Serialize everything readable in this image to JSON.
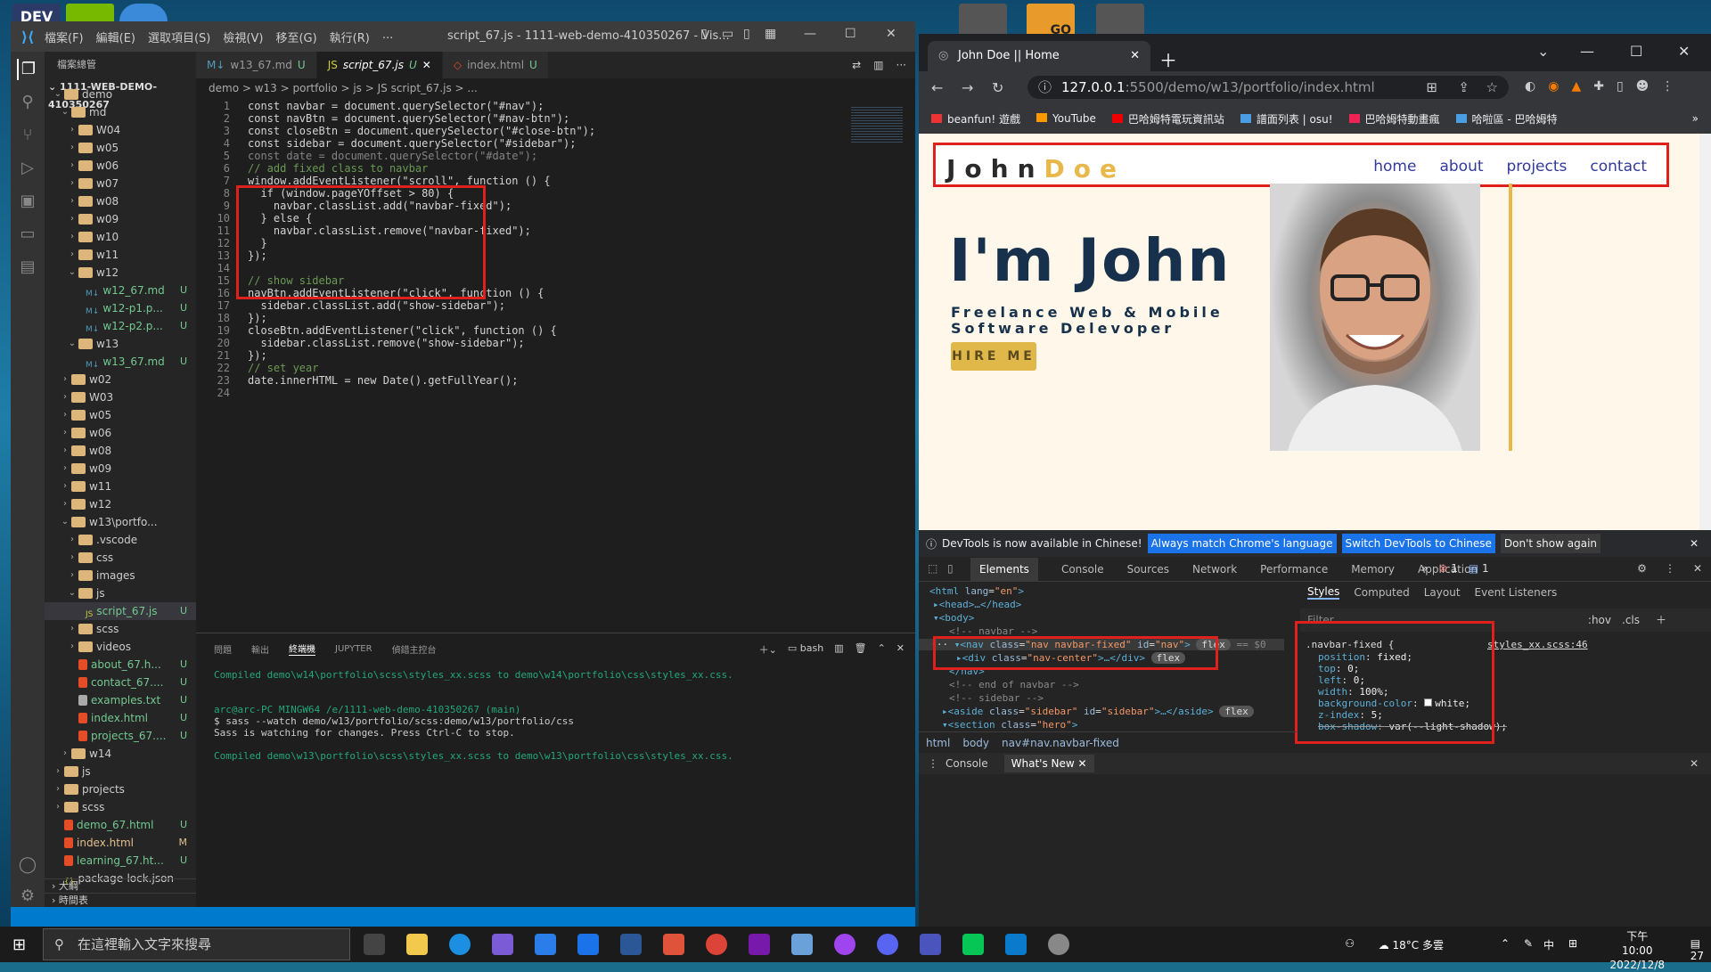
{
  "desktop": {
    "icons": [
      "DEV",
      "",
      "",
      "",
      "GO",
      ""
    ]
  },
  "vscode": {
    "menu": [
      "檔案(F)",
      "編輯(E)",
      "選取項目(S)",
      "檢視(V)",
      "移至(G)",
      "執行(R)",
      "···"
    ],
    "title": "script_67.js - 1111-web-demo-410350267 - Vis...",
    "explorer_header": "檔案總管",
    "project": "1111-WEB-DEMO-410350267",
    "tree": [
      {
        "label": "demo",
        "depth": 1,
        "type": "folder",
        "open": true,
        "status": ""
      },
      {
        "label": "md",
        "depth": 2,
        "type": "folder",
        "open": true,
        "status": ""
      },
      {
        "label": "W04",
        "depth": 3,
        "type": "folder",
        "status": ""
      },
      {
        "label": "w05",
        "depth": 3,
        "type": "folder",
        "status": ""
      },
      {
        "label": "w06",
        "depth": 3,
        "type": "folder",
        "status": ""
      },
      {
        "label": "w07",
        "depth": 3,
        "type": "folder",
        "status": ""
      },
      {
        "label": "w08",
        "depth": 3,
        "type": "folder",
        "status": ""
      },
      {
        "label": "w09",
        "depth": 3,
        "type": "folder",
        "status": ""
      },
      {
        "label": "w10",
        "depth": 3,
        "type": "folder",
        "status": ""
      },
      {
        "label": "w11",
        "depth": 3,
        "type": "folder",
        "status": ""
      },
      {
        "label": "w12",
        "depth": 3,
        "type": "folder",
        "open": true,
        "status": ""
      },
      {
        "label": "w12_67.md",
        "depth": 4,
        "type": "md",
        "status": "U"
      },
      {
        "label": "w12-p1.p...",
        "depth": 4,
        "type": "md",
        "status": "U"
      },
      {
        "label": "w12-p2.p...",
        "depth": 4,
        "type": "md",
        "status": "U"
      },
      {
        "label": "w13",
        "depth": 3,
        "type": "folder",
        "open": true,
        "status": ""
      },
      {
        "label": "w13_67.md",
        "depth": 4,
        "type": "md",
        "status": "U"
      },
      {
        "label": "w02",
        "depth": 2,
        "type": "folder",
        "status": ""
      },
      {
        "label": "W03",
        "depth": 2,
        "type": "folder",
        "status": ""
      },
      {
        "label": "w05",
        "depth": 2,
        "type": "folder",
        "status": ""
      },
      {
        "label": "w06",
        "depth": 2,
        "type": "folder",
        "status": ""
      },
      {
        "label": "w08",
        "depth": 2,
        "type": "folder",
        "status": ""
      },
      {
        "label": "w09",
        "depth": 2,
        "type": "folder",
        "status": ""
      },
      {
        "label": "w11",
        "depth": 2,
        "type": "folder",
        "status": ""
      },
      {
        "label": "w12",
        "depth": 2,
        "type": "folder",
        "status": ""
      },
      {
        "label": "w13\\portfo...",
        "depth": 2,
        "type": "folder",
        "open": true,
        "status": ""
      },
      {
        "label": ".vscode",
        "depth": 3,
        "type": "folder",
        "status": ""
      },
      {
        "label": "css",
        "depth": 3,
        "type": "folder",
        "status": ""
      },
      {
        "label": "images",
        "depth": 3,
        "type": "folder",
        "status": ""
      },
      {
        "label": "js",
        "depth": 3,
        "type": "folder",
        "open": true,
        "status": ""
      },
      {
        "label": "script_67.js",
        "depth": 4,
        "type": "js",
        "status": "U",
        "selected": true
      },
      {
        "label": "scss",
        "depth": 3,
        "type": "folder",
        "status": ""
      },
      {
        "label": "videos",
        "depth": 3,
        "type": "folder",
        "status": ""
      },
      {
        "label": "about_67.h...",
        "depth": 3,
        "type": "html",
        "status": "U"
      },
      {
        "label": "contact_67....",
        "depth": 3,
        "type": "html",
        "status": "U"
      },
      {
        "label": "examples.txt",
        "depth": 3,
        "type": "txt",
        "status": "U"
      },
      {
        "label": "index.html",
        "depth": 3,
        "type": "html",
        "status": "U"
      },
      {
        "label": "projects_67....",
        "depth": 3,
        "type": "html",
        "status": "U"
      },
      {
        "label": "w14",
        "depth": 2,
        "type": "folder",
        "status": ""
      },
      {
        "label": "js",
        "depth": 1,
        "type": "folder",
        "status": ""
      },
      {
        "label": "projects",
        "depth": 1,
        "type": "folder",
        "status": ""
      },
      {
        "label": "scss",
        "depth": 1,
        "type": "folder",
        "status": ""
      },
      {
        "label": "demo_67.html",
        "depth": 1,
        "type": "html",
        "status": "U"
      },
      {
        "label": "index.html",
        "depth": 1,
        "type": "html",
        "status": "M"
      },
      {
        "label": "learning_67.ht...",
        "depth": 1,
        "type": "html",
        "status": "U"
      },
      {
        "label": "package-lock.json",
        "depth": 1,
        "type": "json",
        "status": ""
      }
    ],
    "outline": "大綱",
    "timeline": "時間表",
    "tabs": [
      {
        "label": "w13_67.md",
        "status": "U",
        "active": false
      },
      {
        "label": "script_67.js",
        "status": "U",
        "active": true
      },
      {
        "label": "index.html",
        "status": "U",
        "active": false
      }
    ],
    "breadcrumb": "demo > w13 > portfolio > js > JS script_67.js > ...",
    "code_lines": [
      "const navbar = document.querySelector(\"#nav\");",
      "const navBtn = document.querySelector(\"#nav-btn\");",
      "const closeBtn = document.querySelector(\"#close-btn\");",
      "const sidebar = document.querySelector(\"#sidebar\");",
      "const date = document.querySelector(\"#date\");",
      "// add fixed class to navbar",
      "window.addEventListener(\"scroll\", function () {",
      "  if (window.pageYOffset > 80) {",
      "    navbar.classList.add(\"navbar-fixed\");",
      "  } else {",
      "    navbar.classList.remove(\"navbar-fixed\");",
      "  }",
      "});",
      "",
      "// show sidebar",
      "navBtn.addEventListener(\"click\", function () {",
      "  sidebar.classList.add(\"show-sidebar\");",
      "});",
      "closeBtn.addEventListener(\"click\", function () {",
      "  sidebar.classList.remove(\"show-sidebar\");",
      "});",
      "// set year",
      "date.innerHTML = new Date().getFullYear();",
      ""
    ],
    "panel_tabs": [
      "問題",
      "輸出",
      "終端機",
      "JUPYTER",
      "偵錯主控台"
    ],
    "panel_shell": "bash",
    "terminal": [
      "Compiled demo\\w14\\portfolio\\scss\\styles_xx.scss to demo\\w14\\portfolio\\css\\styles_xx.css.",
      "",
      "",
      "arc@arc-PC MINGW64 /e/1111-web-demo-410350267 (main)",
      "$ sass --watch demo/w13/portfolio/scss:demo/w13/portfolio/css",
      "Sass is watching for changes. Press Ctrl-C to stop.",
      "",
      "Compiled demo\\w13\\portfolio\\scss\\styles_xx.scss to demo\\w13\\portfolio\\css\\styles_xx.css."
    ]
  },
  "chrome": {
    "tab_title": "John Doe || Home",
    "url_host": "127.0.0.1",
    "url_path": ":5500/demo/w13/portfolio/index.html",
    "bookmarks": [
      "beanfun! 遊戲",
      "YouTube",
      "巴哈姆特電玩資訊站",
      "譜面列表 | osu!",
      "巴哈姆特動畫瘋",
      "哈啦區 - 巴哈姆特"
    ],
    "page": {
      "logo_a": "John",
      "logo_b": "Doe",
      "nav": [
        "home",
        "about",
        "projects",
        "contact"
      ],
      "hero_title": "I'm John",
      "hero_sub1": "Freelance Web & Mobile",
      "hero_sub2": "Software Delevoper",
      "hire": "HIRE ME"
    },
    "notice": {
      "text": "DevTools is now available in Chinese!",
      "b1": "Always match Chrome's language",
      "b2": "Switch DevTools to Chinese",
      "b3": "Don't show again"
    },
    "devtools_tabs": [
      "Elements",
      "Console",
      "Sources",
      "Network",
      "Performance",
      "Memory",
      "Application"
    ],
    "errors": "1",
    "messages": "1",
    "styles_tabs": [
      "Styles",
      "Computed",
      "Layout",
      "Event Listeners"
    ],
    "filter": "Filter",
    "hov": ":hov",
    "cls": ".cls",
    "rule_selector": ".navbar-fixed {",
    "rule_source": "styles_xx.scss:46",
    "rule_props": [
      [
        "position",
        "fixed;"
      ],
      [
        "top",
        "0;"
      ],
      [
        "left",
        "0;"
      ],
      [
        "width",
        "100%;"
      ],
      [
        "background-color",
        "white;"
      ],
      [
        "z-index",
        "5;"
      ],
      [
        "box-shadow",
        "var(--light-shadow);"
      ]
    ],
    "breadcrumb": [
      "html",
      "body",
      "nav#nav.navbar-fixed"
    ],
    "drawer": [
      "Console",
      "What's New"
    ]
  },
  "taskbar": {
    "search_placeholder": "在這裡輸入文字來搜尋",
    "weather": "18°C 多雲",
    "ime": "中",
    "time": "下午 10:00",
    "date": "2022/12/8",
    "notifications": "27"
  }
}
